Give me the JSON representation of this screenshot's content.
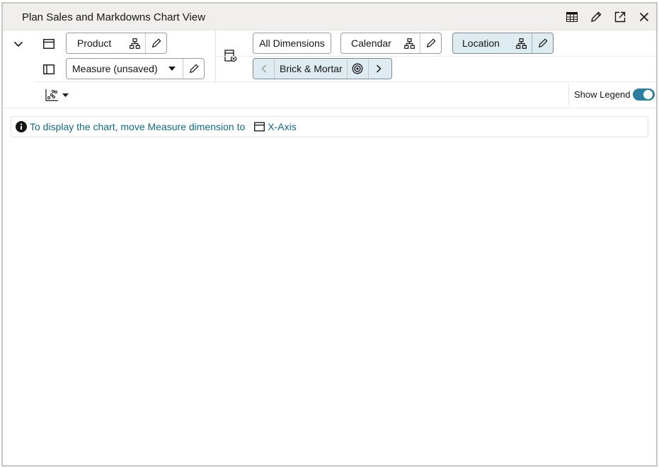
{
  "window": {
    "title": "Plan Sales and Markdowns Chart View",
    "toolbar_icons": [
      "table-icon",
      "edit-icon",
      "expand-icon",
      "close-icon"
    ]
  },
  "dimensions": {
    "product": "Product",
    "measure": "Measure (unsaved)",
    "all_dimensions": "All Dimensions",
    "calendar": "Calendar",
    "location": "Location",
    "location_value": "Brick & Mortar"
  },
  "chart_toolbar": {
    "chart_type_icon": "scatter-chart-icon",
    "show_legend_label": "Show Legend",
    "show_legend_on": true
  },
  "banner": {
    "message": "To display the chart, move Measure dimension to",
    "target": "X-Axis"
  },
  "colors": {
    "accent": "#2b7fa0",
    "link": "#0f6b7e",
    "active_chip": "#deebf1",
    "titlebar": "#f1efed"
  }
}
